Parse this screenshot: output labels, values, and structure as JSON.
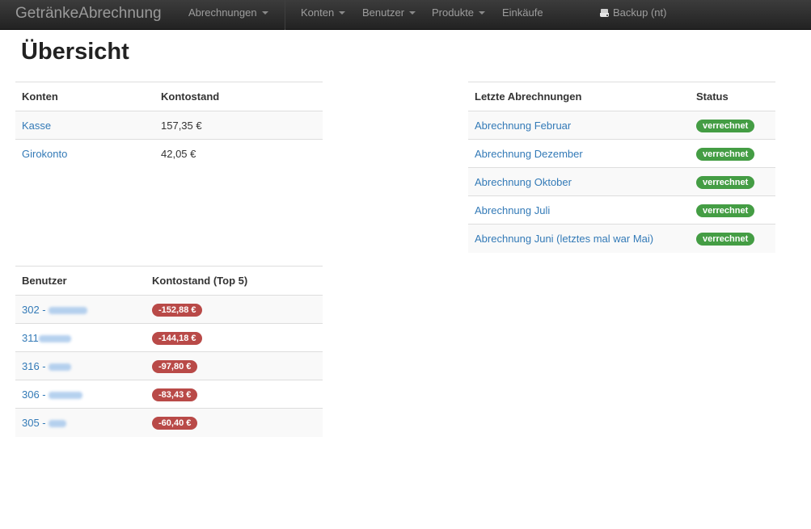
{
  "navbar": {
    "brand": "GetränkeAbrechnung",
    "items": [
      {
        "label": "Abrechnungen",
        "dropdown": true
      },
      {
        "label": "Konten",
        "dropdown": true
      },
      {
        "label": "Benutzer",
        "dropdown": true
      },
      {
        "label": "Produkte",
        "dropdown": true
      },
      {
        "label": "Einkäufe",
        "dropdown": false
      }
    ],
    "backup": {
      "label": "Backup (nt)",
      "icon": "hard-drive-icon"
    }
  },
  "page": {
    "title": "Übersicht"
  },
  "accounts": {
    "headers": [
      "Konten",
      "Kontostand"
    ],
    "rows": [
      {
        "name": "Kasse",
        "balance": "157,35 €"
      },
      {
        "name": "Girokonto",
        "balance": "42,05 €"
      }
    ]
  },
  "billings": {
    "headers": [
      "Letzte Abrechnungen",
      "Status"
    ],
    "rows": [
      {
        "name": "Abrechnung Februar",
        "status": "verrechnet"
      },
      {
        "name": "Abrechnung Dezember",
        "status": "verrechnet"
      },
      {
        "name": "Abrechnung Oktober",
        "status": "verrechnet"
      },
      {
        "name": "Abrechnung Juli",
        "status": "verrechnet"
      },
      {
        "name": "Abrechnung Juni (letztes mal war Mai)",
        "status": "verrechnet"
      }
    ]
  },
  "users": {
    "headers": [
      "Benutzer",
      "Kontostand (Top 5)"
    ],
    "rows": [
      {
        "id": "302 -",
        "balance": "-152,88 €"
      },
      {
        "id": "311",
        "balance": "-144,18 €"
      },
      {
        "id": "316 -",
        "balance": "-97,80 €"
      },
      {
        "id": "306 -",
        "balance": "-83,43 €"
      },
      {
        "id": "305 -",
        "balance": "-60,40 €"
      }
    ]
  },
  "colors": {
    "navbar": "#222222",
    "link": "#337ab7",
    "success": "#449d44",
    "danger": "#b94a48"
  }
}
